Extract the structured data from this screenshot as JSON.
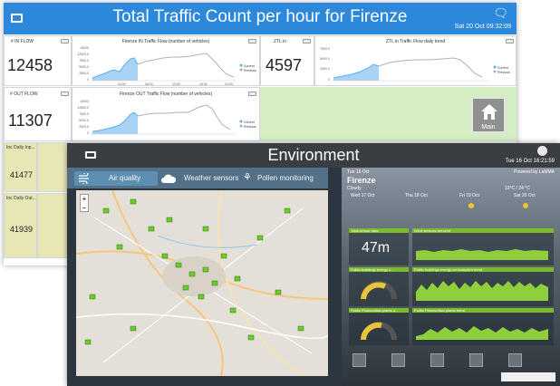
{
  "traffic": {
    "title": "Total Traffic Count per hour for Firenze",
    "datetime": "Sat 20 Oct 09:32:09",
    "in_flow": {
      "label": "# IN FLOW",
      "value": "12458",
      "chart_title": "Firenze IN Traffic Flow (number of vehicles)",
      "y_ticks": [
        "15000",
        "12500.0",
        "7500.0",
        "5000.0",
        "2500.0",
        "0"
      ]
    },
    "ztl_in": {
      "label": "ZTL in",
      "value": "4597",
      "chart_title": "ZTL in Traffic Flow daily trend",
      "y_ticks": [
        "7500.0",
        "5000.0",
        "2500.0",
        "0"
      ]
    },
    "out_flow": {
      "label": "# OUT FLOW",
      "value": "11307",
      "chart_title": "Firenze OUT Traffic Flow (number of vehicles)",
      "y_ticks": [
        "15000",
        "12500.0",
        "7500.0",
        "5000.0",
        "2500.0",
        "0"
      ]
    },
    "legend": [
      "Current",
      "Previous"
    ],
    "x_ticks": [
      "04:00",
      "08:00",
      "12:00",
      "16:00",
      "20:00"
    ],
    "home_label": "Main",
    "inc_daily_in": {
      "label": "Inc Daily Inp...",
      "value": "41477"
    },
    "inc_daily_out": {
      "label": "Inc Daily Out...",
      "value": "41939"
    },
    "colors": {
      "header": "#2b88db",
      "green_panel": "#d4edc3",
      "yellow_panel": "#e7e6b5",
      "current_series": "#5ab0f0",
      "previous_series": "#b0b0b0"
    }
  },
  "environment": {
    "title": "Environment",
    "datetime": "Tue 16 Oct 16:21:59",
    "tabs": [
      "Air quality",
      "Weather sensors",
      "Pollen monitoring"
    ],
    "map_zoom": [
      "+",
      "−"
    ],
    "weather": {
      "date": "Tue 16 Oct",
      "powered": "Powered by LaMMA",
      "city": "Firenze",
      "condition": "Cloudy",
      "temps": "19°C / 24 °C",
      "days": [
        "Wed 17 Oct",
        "Thu 18 Oct",
        "Fri 19 Oct",
        "Sat 20 Oct"
      ]
    },
    "panels": [
      {
        "label": "Total sensor data",
        "value": "47m",
        "chart": "Wind sensors-trend/ref"
      },
      {
        "label": "Public buildings energy c...",
        "chart": "Public buildings energy consumption trend"
      },
      {
        "label": "Public Photovoltaic plants d...",
        "chart": "Public Photovoltaic plants trend"
      }
    ],
    "bottom_icons": [
      "mobility-icon",
      "document-icon",
      "network-icon",
      "building-icon",
      "home-icon"
    ],
    "colors": {
      "header": "#3a3d42",
      "tabs": "#546f88",
      "accent_green": "#7bbb2b",
      "sensor_marker": "#6ec92c"
    }
  }
}
